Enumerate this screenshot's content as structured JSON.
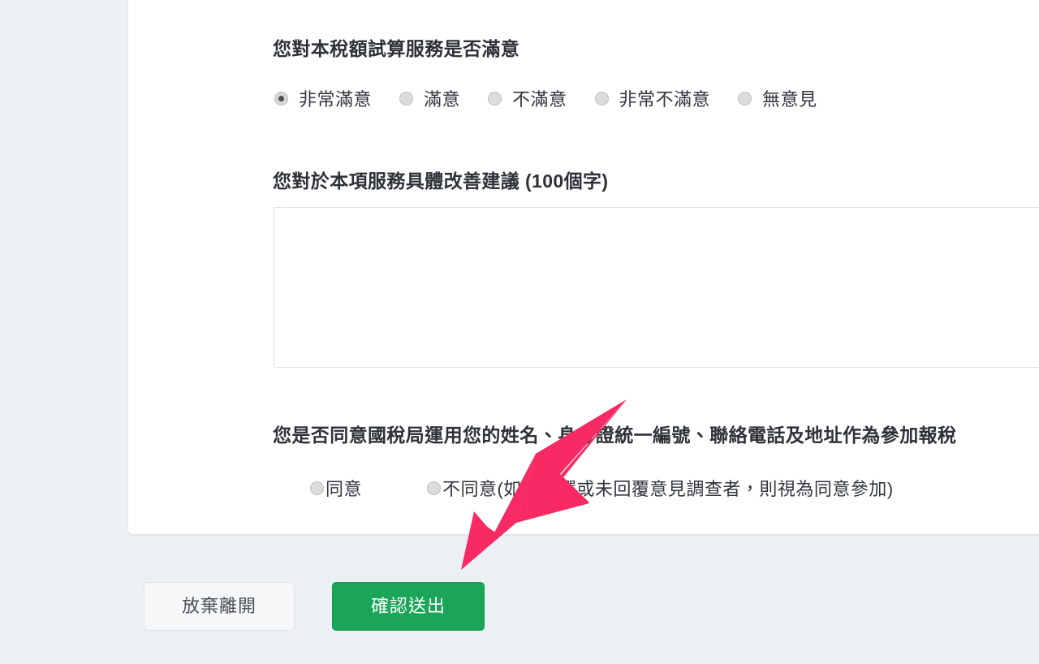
{
  "survey": {
    "questions": [
      {
        "id": "satisfaction",
        "title": "您對本稅額試算服務是否滿意",
        "options": [
          {
            "label": "非常滿意",
            "checked": true
          },
          {
            "label": "滿意",
            "checked": false
          },
          {
            "label": "不滿意",
            "checked": false
          },
          {
            "label": "非常不滿意",
            "checked": false
          },
          {
            "label": "無意見",
            "checked": false
          }
        ]
      },
      {
        "id": "suggestion",
        "title": "您對於本項服務具體改善建議 (100個字)",
        "value": "",
        "placeholder": ""
      },
      {
        "id": "consent",
        "title": "您是否同意國稅局運用您的姓名、身分證統一編號、聯絡電話及地址作為參加報稅",
        "options": [
          {
            "label": "同意",
            "checked": false
          },
          {
            "label": "不同意",
            "checked": false
          }
        ],
        "note": "(如未勾選或未回覆意見調查者，則視為同意參加)"
      }
    ]
  },
  "footer": {
    "cancel_label": "放棄離開",
    "submit_label": "確認送出"
  },
  "annotation": {
    "arrow_color": "#f72a63"
  },
  "colors": {
    "page_background": "#eceff4",
    "card_background": "#ffffff",
    "submit_green": "#1aa558",
    "text_primary": "#31363c"
  }
}
